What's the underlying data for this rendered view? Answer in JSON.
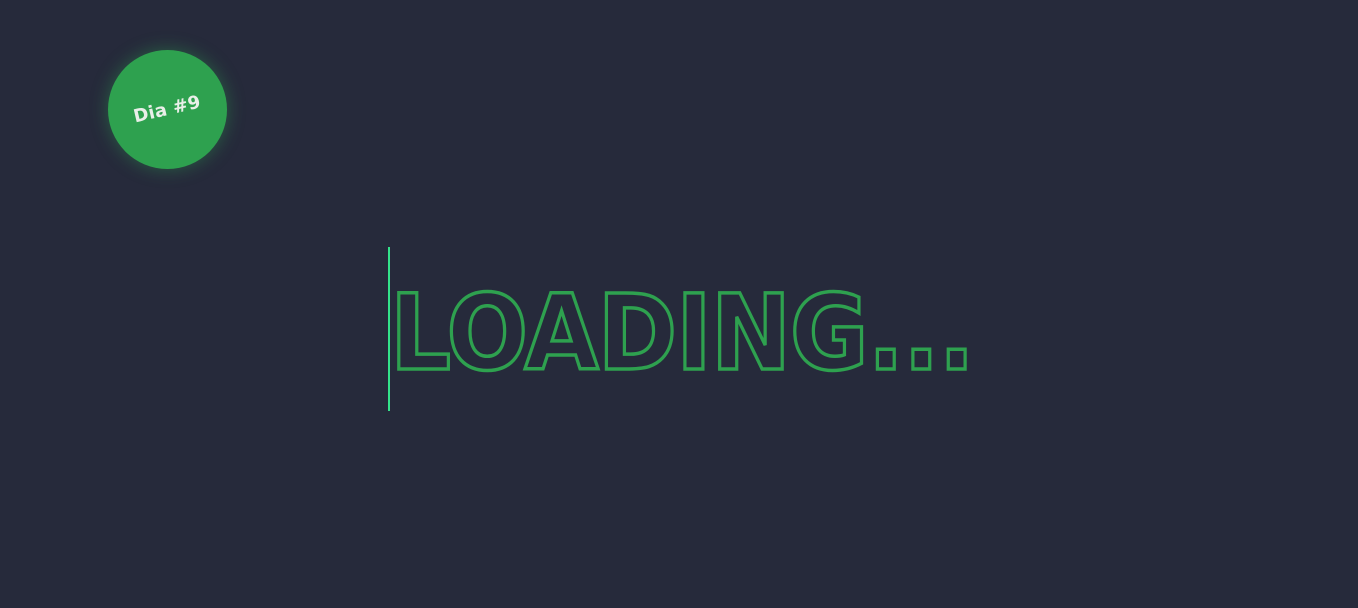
{
  "badge": {
    "label": "Dia #9"
  },
  "loader": {
    "text": "LOADING..."
  },
  "colors": {
    "background": "#262a3b",
    "accent": "#2ea14f",
    "cursor": "#33e38a",
    "badge_text": "#e9efe9"
  }
}
